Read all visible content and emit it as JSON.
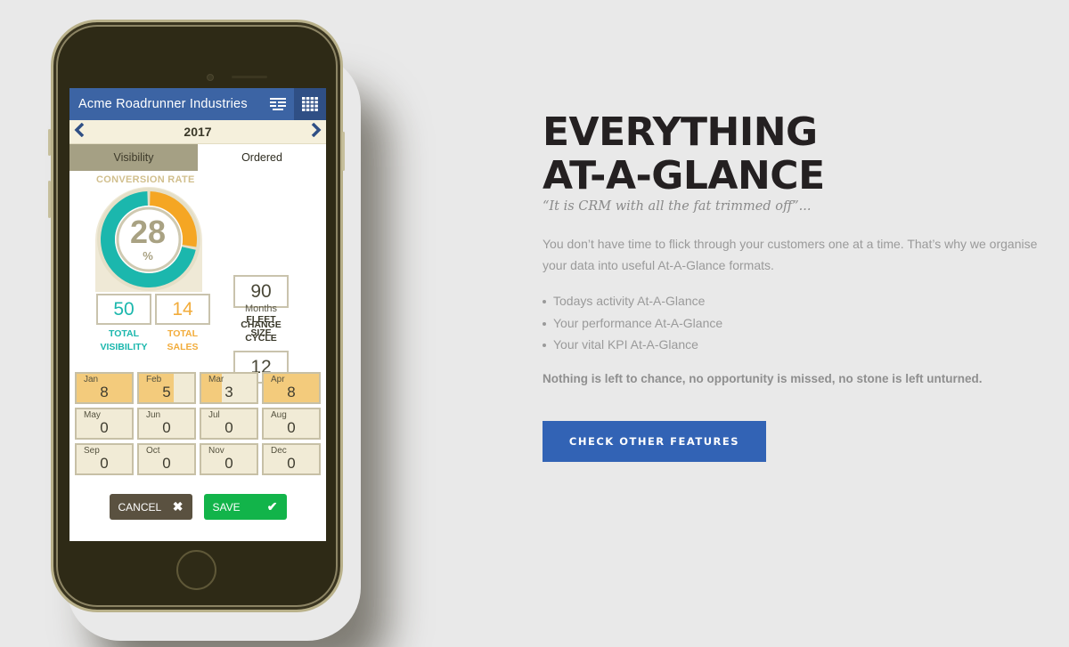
{
  "phone_app": {
    "header": {
      "title": "Acme Roadrunner Industries",
      "icons": [
        "list-view-icon",
        "grid-view-icon"
      ],
      "color": "#3c64a4"
    },
    "year_nav": {
      "prev": "‹",
      "year": "2017",
      "next": "›"
    },
    "tabs": [
      {
        "label": "Visibility",
        "active": false
      },
      {
        "label": "Ordered",
        "active": true
      }
    ],
    "conversion": {
      "label": "CONVERSION RATE",
      "value": "28",
      "unit": "%",
      "percent": 28,
      "colors": {
        "rate": "#f5a623",
        "remainder": "#1bb7ad"
      }
    },
    "totals": {
      "visibility": {
        "value": "50",
        "label_line1": "TOTAL",
        "label_line2": "VISIBILITY"
      },
      "sales": {
        "value": "14",
        "label_line1": "TOTAL",
        "label_line2": "SALES"
      }
    },
    "fleet": {
      "value": "90",
      "label_line1": "FLEET",
      "label_line2": "SIZE"
    },
    "cycle": {
      "value": "12",
      "unit": "Months",
      "label_line1": "CHANGE",
      "label_line2": "CYCLE"
    },
    "months": [
      {
        "name": "Jan",
        "value": "8",
        "fill": 1.0
      },
      {
        "name": "Feb",
        "value": "5",
        "fill": 0.625
      },
      {
        "name": "Mar",
        "value": "3",
        "fill": 0.375
      },
      {
        "name": "Apr",
        "value": "8",
        "fill": 1.0
      },
      {
        "name": "May",
        "value": "0",
        "fill": 0
      },
      {
        "name": "Jun",
        "value": "0",
        "fill": 0
      },
      {
        "name": "Jul",
        "value": "0",
        "fill": 0
      },
      {
        "name": "Aug",
        "value": "0",
        "fill": 0
      },
      {
        "name": "Sep",
        "value": "0",
        "fill": 0
      },
      {
        "name": "Oct",
        "value": "0",
        "fill": 0
      },
      {
        "name": "Nov",
        "value": "0",
        "fill": 0
      },
      {
        "name": "Dec",
        "value": "0",
        "fill": 0
      }
    ],
    "actions": {
      "cancel": {
        "label": "CANCEL",
        "icon": "✖"
      },
      "save": {
        "label": "SAVE",
        "icon": "✔"
      }
    }
  },
  "content": {
    "headline_line1": "EVERYTHING",
    "headline_line2": "AT-A-GLANCE",
    "tagline": "“It is CRM with all the fat trimmed off”...",
    "paragraph": "You don’t have time to flick through your customers one at a time. That’s why we organise your data into useful At-A-Glance formats.",
    "bullets": [
      "Todays activity At-A-Glance",
      "Your performance At-A-Glance",
      "Your vital KPI At-A-Glance"
    ],
    "closing": "Nothing is left to chance, no opportunity is missed, no stone is left unturned.",
    "cta_label": "CHECK OTHER FEATURES",
    "cta_color": "#3263b5"
  }
}
